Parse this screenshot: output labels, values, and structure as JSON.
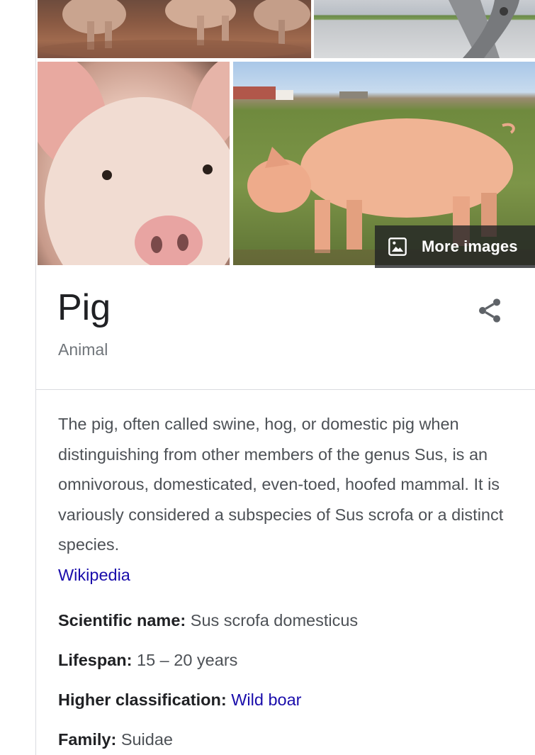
{
  "knowledge_panel": {
    "more_images_label": "More images",
    "title": "Pig",
    "subtitle": "Animal",
    "description": "The pig, often called swine, hog, or domestic pig when distinguishing from other members of the genus Sus, is an omnivorous, domesticated, even-toed, hoofed mammal. It is variously considered a subspecies of Sus scrofa or a distinct species.",
    "source_link": "Wikipedia",
    "facts": [
      {
        "label": "Scientific name:",
        "value": "Sus scrofa domesticus"
      },
      {
        "label": "Lifespan:",
        "value": "15 – 20 years"
      },
      {
        "label": "Higher classification:",
        "value": "Wild boar"
      },
      {
        "label": "Family:",
        "value": "Suidae"
      }
    ]
  },
  "icons": {
    "more_images": "image-icon",
    "share": "share-icon"
  },
  "colors": {
    "link": "#1a0dab",
    "title": "#202124",
    "body_text": "#4d5156",
    "subtitle": "#70757a",
    "divider": "#dadce0"
  }
}
